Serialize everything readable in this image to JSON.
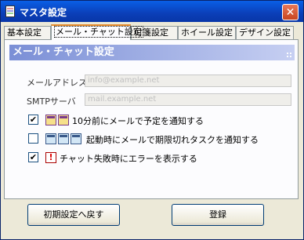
{
  "window": {
    "title": "マスタ設定",
    "close_symbol": "✕"
  },
  "tabs": [
    {
      "label": "基本設定",
      "active": false
    },
    {
      "label": "メール・チャット設定",
      "active": true
    },
    {
      "label": "付箋設定",
      "active": false
    },
    {
      "label": "ホイール設定",
      "active": false
    },
    {
      "label": "デザイン設定",
      "active": false
    }
  ],
  "panel": {
    "header": "メール・チャット設定",
    "email": {
      "label": "メールアドレス",
      "value": "info@example.net"
    },
    "smtp": {
      "label": "SMTPサーバ",
      "value": "mail.example.net"
    },
    "options": [
      {
        "checked": true,
        "mark": "✔",
        "label": "10分前にメールで予定を通知する",
        "icons": [
          "calendar-icon",
          "calendar-icon"
        ]
      },
      {
        "checked": false,
        "mark": "",
        "label": "起動時にメールで期限切れタスクを通知する",
        "icons": [
          "calendar-icon",
          "calendar-icon",
          "calendar-icon"
        ]
      },
      {
        "checked": true,
        "mark": "✔",
        "label": "チャット失敗時にエラーを表示する",
        "icons": [
          "alert-icon"
        ]
      }
    ],
    "alert_glyph": "!"
  },
  "buttons": {
    "reset": "初期設定へ戻す",
    "register": "登録"
  }
}
